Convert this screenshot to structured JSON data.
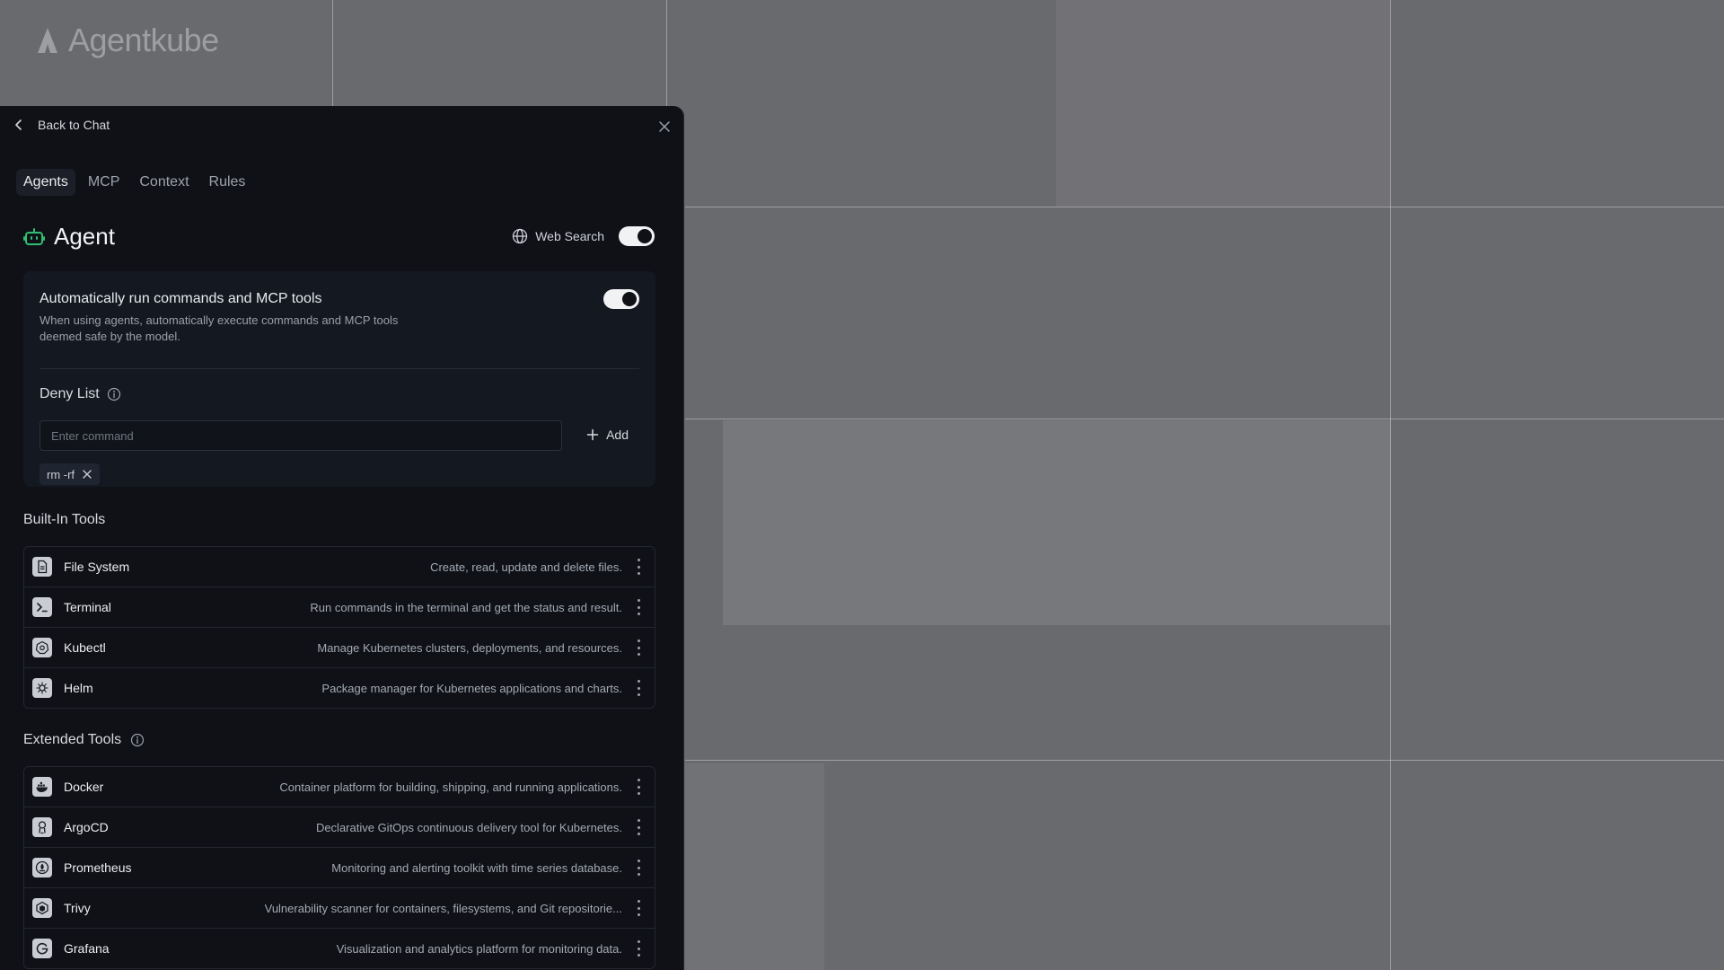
{
  "brand": {
    "name": "Agentkube"
  },
  "nav": {
    "back_label": "Back to Chat"
  },
  "tabs": [
    {
      "label": "Agents",
      "active": true
    },
    {
      "label": "MCP",
      "active": false
    },
    {
      "label": "Context",
      "active": false
    },
    {
      "label": "Rules",
      "active": false
    }
  ],
  "agent": {
    "title": "Agent",
    "web_search_label": "Web Search",
    "web_search_enabled": true
  },
  "auto_run": {
    "title": "Automatically run commands and MCP tools",
    "description": "When using agents, automatically execute commands and MCP tools deemed safe by the model.",
    "enabled": true
  },
  "deny_list": {
    "label": "Deny List",
    "input_placeholder": "Enter command",
    "input_value": "",
    "add_label": "Add",
    "items": [
      "rm -rf"
    ]
  },
  "built_in_tools": {
    "label": "Built-In Tools",
    "items": [
      {
        "name": "File System",
        "description": "Create, read, update and delete files.",
        "icon": "file-icon"
      },
      {
        "name": "Terminal",
        "description": "Run commands in the terminal and get the status and result.",
        "icon": "terminal-icon"
      },
      {
        "name": "Kubectl",
        "description": "Manage Kubernetes clusters, deployments, and resources.",
        "icon": "kubernetes-icon"
      },
      {
        "name": "Helm",
        "description": "Package manager for Kubernetes applications and charts.",
        "icon": "helm-icon"
      }
    ]
  },
  "extended_tools": {
    "label": "Extended Tools",
    "items": [
      {
        "name": "Docker",
        "description": "Container platform for building, shipping, and running applications.",
        "icon": "docker-icon"
      },
      {
        "name": "ArgoCD",
        "description": "Declarative GitOps continuous delivery tool for Kubernetes.",
        "icon": "argocd-icon"
      },
      {
        "name": "Prometheus",
        "description": "Monitoring and alerting toolkit with time series database.",
        "icon": "prometheus-icon"
      },
      {
        "name": "Trivy",
        "description": "Vulnerability scanner for containers, filesystems, and Git repositorie...",
        "icon": "trivy-icon"
      },
      {
        "name": "Grafana",
        "description": "Visualization and analytics platform for monitoring data.",
        "icon": "grafana-icon"
      }
    ]
  },
  "colors": {
    "panel_bg": "#0f1117",
    "accent_green": "#2fbf71"
  }
}
